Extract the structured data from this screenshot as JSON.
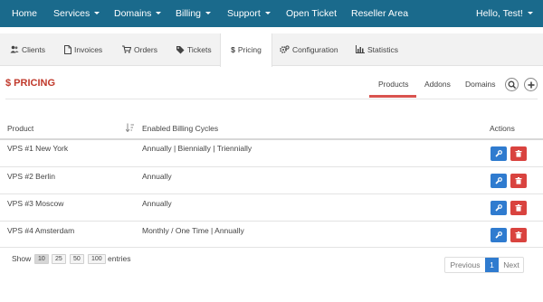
{
  "nav": {
    "items": [
      {
        "label": "Home",
        "dropdown": false
      },
      {
        "label": "Services",
        "dropdown": true
      },
      {
        "label": "Domains",
        "dropdown": true
      },
      {
        "label": "Billing",
        "dropdown": true
      },
      {
        "label": "Support",
        "dropdown": true
      },
      {
        "label": "Open Ticket",
        "dropdown": false
      },
      {
        "label": "Reseller Area",
        "dropdown": false
      }
    ],
    "user": "Hello, Test!",
    "color": "#1a6a8c"
  },
  "subtabs": [
    {
      "label": "Clients",
      "icon": "users-icon"
    },
    {
      "label": "Invoices",
      "icon": "document-icon"
    },
    {
      "label": "Orders",
      "icon": "cart-icon"
    },
    {
      "label": "Tickets",
      "icon": "tag-icon"
    },
    {
      "label": "Pricing",
      "icon": "dollar-icon",
      "active": true
    },
    {
      "label": "Configuration",
      "icon": "cogs-icon"
    },
    {
      "label": "Statistics",
      "icon": "bar-chart-icon"
    }
  ],
  "page": {
    "title": "$ PRICING",
    "title_color": "#c0392b",
    "tabs": [
      {
        "label": "Products",
        "active": true
      },
      {
        "label": "Addons"
      },
      {
        "label": "Domains"
      }
    ]
  },
  "table": {
    "headers": {
      "product": "Product",
      "cycles": "Enabled Billing Cycles",
      "actions": "Actions"
    },
    "rows": [
      {
        "product": "VPS #1 New York",
        "cycles": "Annually | Biennially | Triennially"
      },
      {
        "product": "VPS #2 Berlin",
        "cycles": "Annually"
      },
      {
        "product": "VPS #3 Moscow",
        "cycles": "Annually"
      },
      {
        "product": "VPS #4 Amsterdam",
        "cycles": "Monthly / One Time | Annually"
      }
    ]
  },
  "footer": {
    "show_label": "Show",
    "page_sizes": [
      "10",
      "25",
      "50",
      "100"
    ],
    "selected_page_size": "10",
    "entries_label": "entries",
    "pagination": {
      "previous": "Previous",
      "current": "1",
      "next": "Next"
    }
  },
  "colors": {
    "edit": "#2f7bcf",
    "delete": "#d9433f",
    "accent": "#d9534f"
  }
}
